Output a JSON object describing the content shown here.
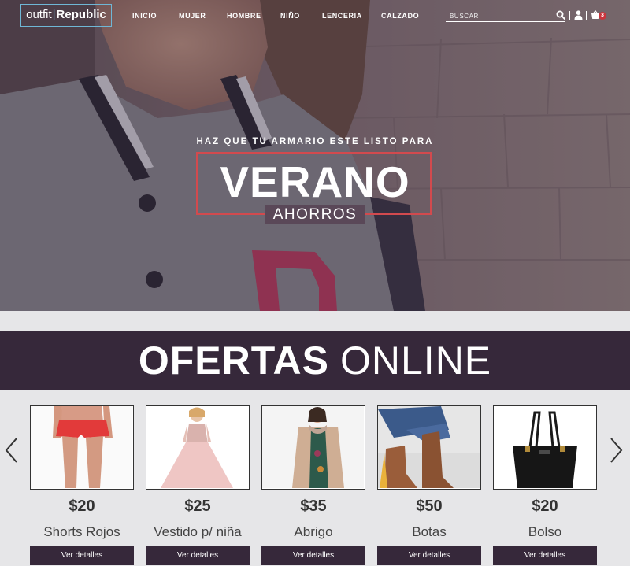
{
  "header": {
    "logo": {
      "part1": "outfit",
      "separator": "|",
      "part2": "Republic"
    },
    "nav": [
      "INICIO",
      "MUJER",
      "HOMBRE",
      "NIÑO",
      "LENCERIA",
      "CALZADO"
    ],
    "search": {
      "placeholder": "BUSCAR",
      "value": ""
    },
    "icons": [
      "search-icon",
      "user-icon",
      "cart-icon"
    ],
    "cart_count": "3"
  },
  "hero": {
    "kicker": "HAZ QUE TU ARMARIO ESTE LISTO PARA",
    "title": "VERANO",
    "subtitle": "AHORROS"
  },
  "offers": {
    "title_bold": "OFERTAS",
    "title_light": "ONLINE",
    "prev_icon": "chevron-left-icon",
    "next_icon": "chevron-right-icon",
    "products": [
      {
        "price": "$20",
        "name": "Shorts Rojos",
        "button": "Ver detalles"
      },
      {
        "price": "$25",
        "name": "Vestido p/ niña",
        "button": "Ver detalles"
      },
      {
        "price": "$35",
        "name": "Abrigo",
        "button": "Ver detalles"
      },
      {
        "price": "$50",
        "name": "Botas",
        "button": "Ver detalles"
      },
      {
        "price": "$20",
        "name": "Bolso",
        "button": "Ver detalles"
      }
    ]
  },
  "colors": {
    "dark_purple": "#36283a",
    "accent_red": "#d24a4e",
    "logo_border": "#6fb7d6",
    "badge": "#c9353d"
  }
}
